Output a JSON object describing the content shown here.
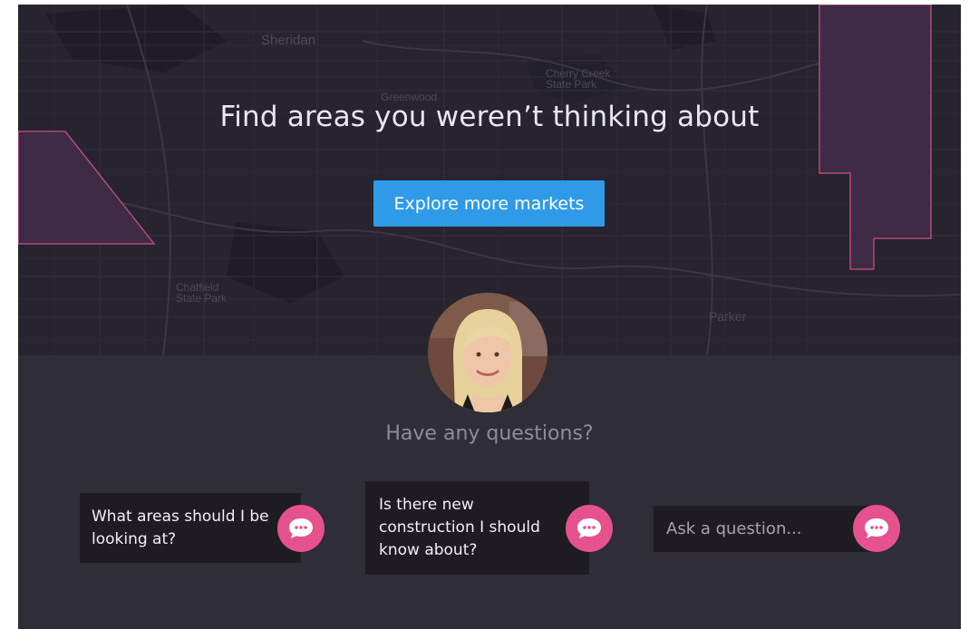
{
  "map": {
    "places": [
      "Sheridan",
      "Greenwood",
      "Cherry Creek State Park",
      "Chatfield State Park",
      "Parker"
    ]
  },
  "hero": {
    "title": "Find areas you weren’t thinking about",
    "cta_label": "Explore more markets"
  },
  "agent": {
    "heading": "Have any questions?"
  },
  "questions": [
    {
      "text": "What areas should I be looking at?"
    },
    {
      "text": "Is there new construction I should know about?"
    }
  ],
  "ask": {
    "placeholder": "Ask a question..."
  },
  "icons": {
    "chat": "chat-bubble-icon"
  },
  "colors": {
    "accent": "#2f9be8",
    "chat_button": "#e5528f",
    "region_outline": "#b04a7f"
  }
}
